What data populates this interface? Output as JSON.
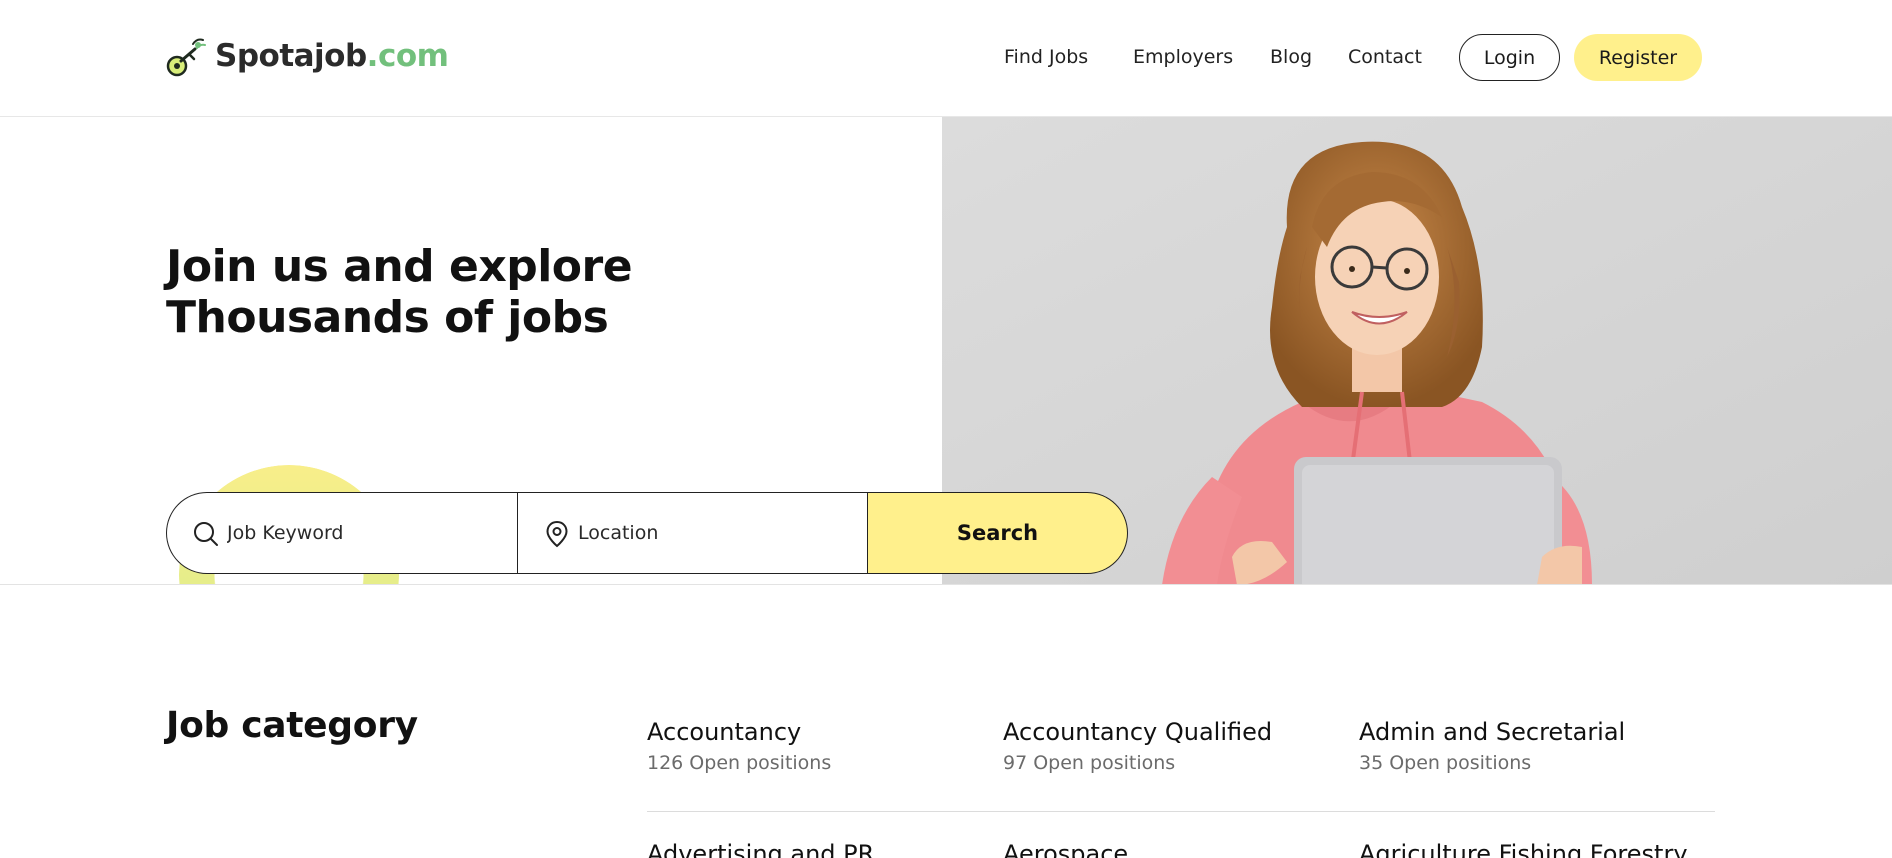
{
  "brand": {
    "name_main": "Spotajob",
    "name_accent": ".com",
    "accent_color": "#72c07c"
  },
  "nav": {
    "items": [
      {
        "label": "Find Jobs"
      },
      {
        "label": "Employers"
      },
      {
        "label": "Blog"
      },
      {
        "label": "Contact"
      }
    ],
    "login_label": "Login",
    "register_label": "Register"
  },
  "hero": {
    "title_line1": "Join us and explore",
    "title_line2": "Thousands of jobs",
    "search": {
      "keyword_placeholder": "Job Keyword",
      "location_placeholder": "Location",
      "button_label": "Search"
    },
    "accent_color": "#fff08c"
  },
  "job_category": {
    "title": "Job category",
    "categories": [
      {
        "name": "Accountancy",
        "count": "126 Open positions"
      },
      {
        "name": "Accountancy Qualified",
        "count": "97 Open positions"
      },
      {
        "name": "Admin and Secretarial",
        "count": "35 Open positions"
      },
      {
        "name": "Advertising and PR",
        "count": ""
      },
      {
        "name": "Aerospace",
        "count": ""
      },
      {
        "name": "Agriculture Fishing Forestry",
        "count": ""
      }
    ]
  },
  "icons": {
    "keyword": "search-icon",
    "location": "location-pin-icon",
    "logo": "spotajob-logo-icon"
  }
}
